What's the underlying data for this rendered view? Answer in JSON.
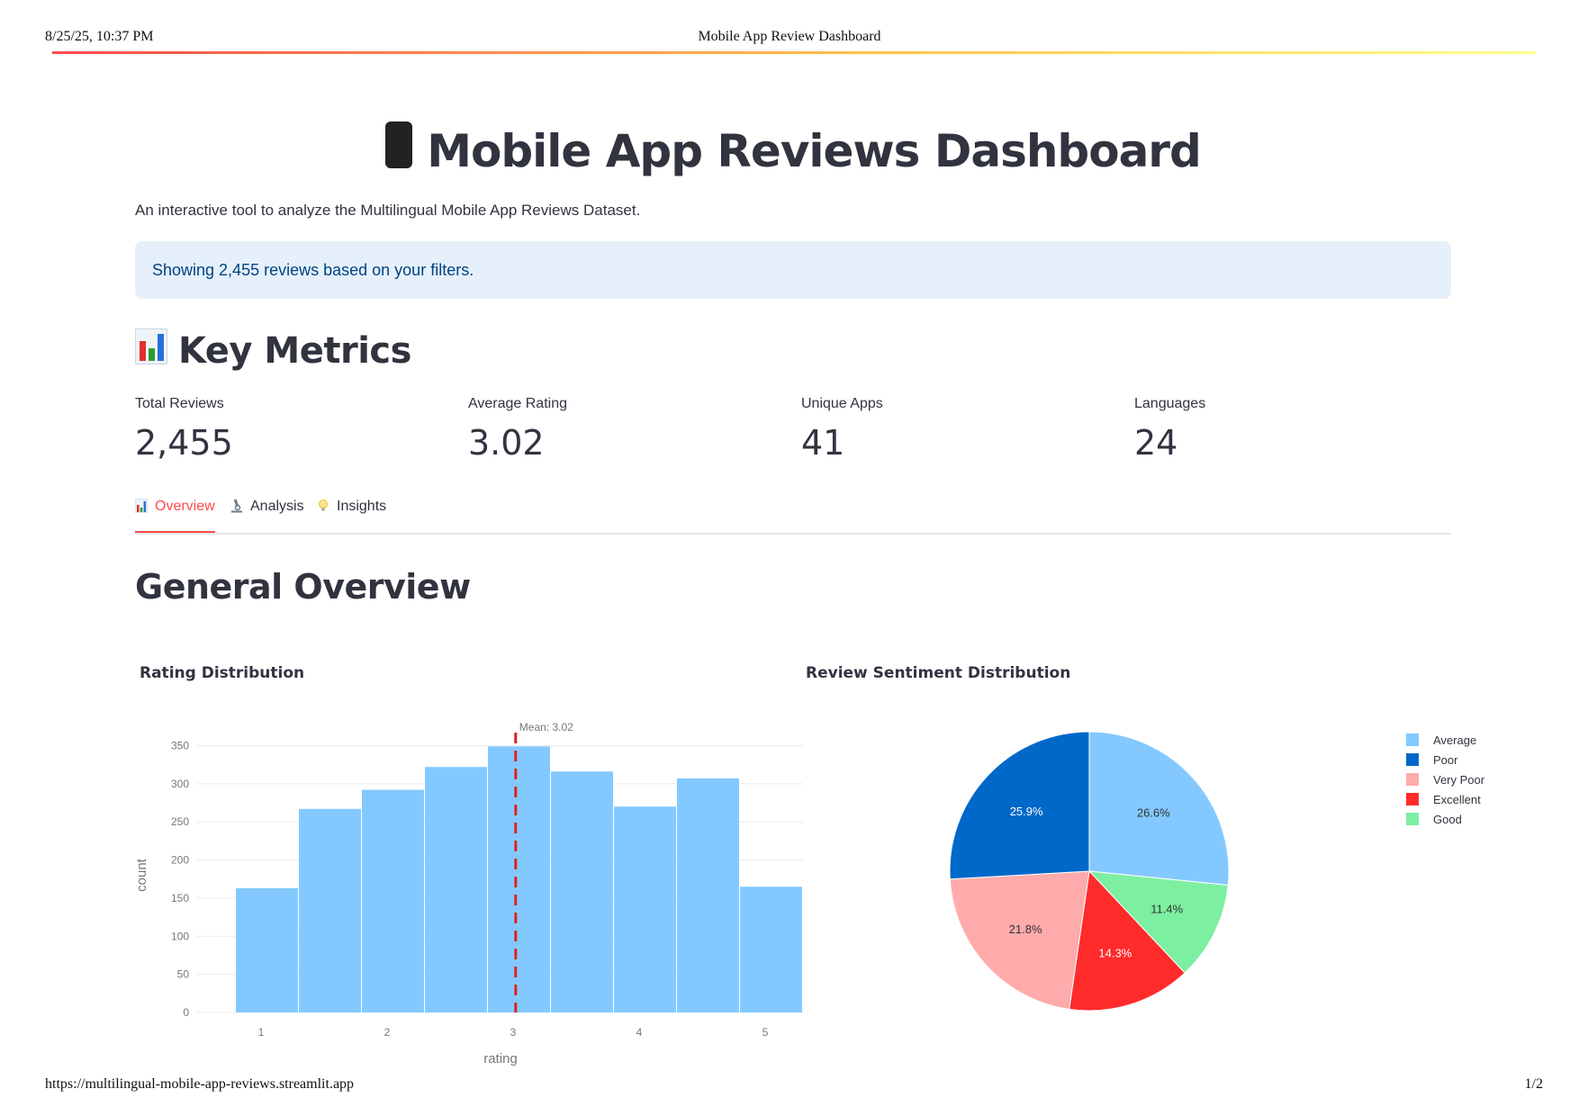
{
  "print_header": {
    "date": "8/25/25, 10:37 PM",
    "title": "Mobile App Review Dashboard"
  },
  "print_footer": {
    "url": "https://multilingual-mobile-app-reviews.streamlit.app",
    "page": "1/2"
  },
  "page": {
    "title": "Mobile App Reviews Dashboard",
    "title_icon": "mobile-phone-icon",
    "subtitle": "An interactive tool to analyze the Multilingual Mobile App Reviews Dataset.",
    "info": "Showing 2,455 reviews based on your filters."
  },
  "key_metrics": {
    "heading": "Key Metrics",
    "icon": "bar-chart-icon",
    "items": [
      {
        "label": "Total Reviews",
        "value": "2,455"
      },
      {
        "label": "Average Rating",
        "value": "3.02"
      },
      {
        "label": "Unique Apps",
        "value": "41"
      },
      {
        "label": "Languages",
        "value": "24"
      }
    ]
  },
  "tabs": [
    {
      "label": "Overview",
      "icon": "bar-chart-icon",
      "active": true
    },
    {
      "label": "Analysis",
      "icon": "microscope-icon",
      "active": false
    },
    {
      "label": "Insights",
      "icon": "light-bulb-icon",
      "active": false
    }
  ],
  "overview": {
    "heading": "General Overview"
  },
  "colors": {
    "accent": "#ff4b4b",
    "info_bg": "#e5f0fa",
    "info_text": "#004280",
    "histogram_bar": "#83c9ff",
    "mean_line": "#dd2222"
  },
  "chart_data": [
    {
      "type": "bar",
      "title": "Rating Distribution",
      "xlabel": "rating",
      "ylabel": "count",
      "x_ticks": [
        1,
        2,
        3,
        4,
        5
      ],
      "y_ticks": [
        0,
        50,
        100,
        150,
        200,
        250,
        300,
        350
      ],
      "xlim": [
        0.5,
        5.3
      ],
      "ylim": [
        0,
        360
      ],
      "bins": [
        {
          "start": 0.8,
          "end": 1.3,
          "count": 163
        },
        {
          "start": 1.3,
          "end": 1.8,
          "count": 267
        },
        {
          "start": 1.8,
          "end": 2.3,
          "count": 292
        },
        {
          "start": 2.3,
          "end": 2.8,
          "count": 322
        },
        {
          "start": 2.8,
          "end": 3.3,
          "count": 349
        },
        {
          "start": 3.3,
          "end": 3.8,
          "count": 316
        },
        {
          "start": 3.8,
          "end": 4.3,
          "count": 270
        },
        {
          "start": 4.3,
          "end": 4.8,
          "count": 307
        },
        {
          "start": 4.8,
          "end": 5.3,
          "count": 165
        }
      ],
      "mean": 3.02,
      "mean_label": "Mean: 3.02",
      "grid": true
    },
    {
      "type": "pie",
      "title": "Review Sentiment Distribution",
      "legend_position": "right",
      "slices": [
        {
          "label": "Average",
          "percent": 26.6,
          "color": "#83c9ff"
        },
        {
          "label": "Good",
          "percent": 11.4,
          "color": "#7defa1"
        },
        {
          "label": "Excellent",
          "percent": 14.3,
          "color": "#ff2b2b"
        },
        {
          "label": "Very Poor",
          "percent": 21.8,
          "color": "#ffabab"
        },
        {
          "label": "Poor",
          "percent": 25.9,
          "color": "#0068c9"
        }
      ],
      "legend_order": [
        "Average",
        "Poor",
        "Very Poor",
        "Excellent",
        "Good"
      ]
    }
  ]
}
